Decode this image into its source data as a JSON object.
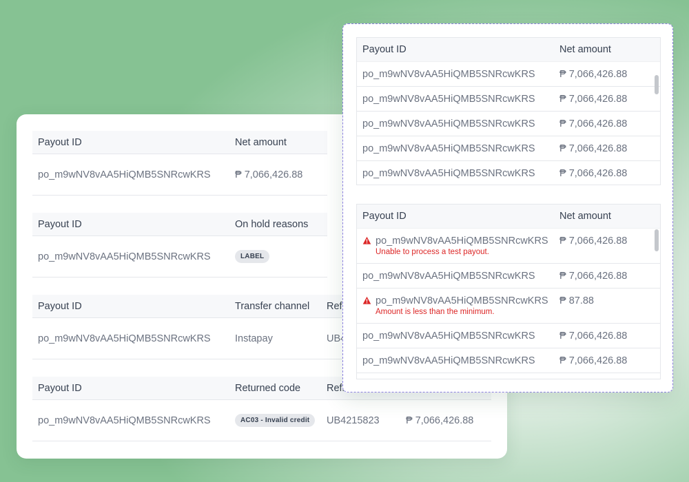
{
  "colors": {
    "error": "#dc2626",
    "dashed_border": "#8b7fe0",
    "header_bg": "#f7f8fa",
    "pill_bg": "#e5e7eb"
  },
  "back_card": {
    "tables": [
      {
        "headers": [
          "Payout ID",
          "Net amount"
        ],
        "row": {
          "payout_id": "po_m9wNV8vAA5HiQMB5SNRcwKRS",
          "col2": "₱ 7,066,426.88"
        }
      },
      {
        "headers": [
          "Payout ID",
          "On hold reasons"
        ],
        "row": {
          "payout_id": "po_m9wNV8vAA5HiQMB5SNRcwKRS",
          "label": "LABEL"
        }
      },
      {
        "headers": [
          "Payout ID",
          "Transfer channel",
          "Refi"
        ],
        "row": {
          "payout_id": "po_m9wNV8vAA5HiQMB5SNRcwKRS",
          "col2": "Instapay",
          "col3": "UB4"
        }
      },
      {
        "headers": [
          "Payout ID",
          "Returned code",
          "Refi"
        ],
        "row": {
          "payout_id": "po_m9wNV8vAA5HiQMB5SNRcwKRS",
          "code_pill": "AC03 - Invalid credit",
          "col3": "UB4215823",
          "col4": "₱ 7,066,426.88"
        }
      }
    ]
  },
  "front_panel": {
    "table1": {
      "headers": [
        "Payout ID",
        "Net amount"
      ],
      "rows": [
        {
          "payout_id": "po_m9wNV8vAA5HiQMB5SNRcwKRS",
          "amount": "₱ 7,066,426.88"
        },
        {
          "payout_id": "po_m9wNV8vAA5HiQMB5SNRcwKRS",
          "amount": "₱ 7,066,426.88"
        },
        {
          "payout_id": "po_m9wNV8vAA5HiQMB5SNRcwKRS",
          "amount": "₱ 7,066,426.88"
        },
        {
          "payout_id": "po_m9wNV8vAA5HiQMB5SNRcwKRS",
          "amount": "₱ 7,066,426.88"
        },
        {
          "payout_id": "po_m9wNV8vAA5HiQMB5SNRcwKRS",
          "amount": "₱ 7,066,426.88"
        }
      ]
    },
    "table2": {
      "headers": [
        "Payout ID",
        "Net amount"
      ],
      "rows": [
        {
          "payout_id": "po_m9wNV8vAA5HiQMB5SNRcwKRS",
          "amount": "₱ 7,066,426.88",
          "error": "Unable to process a test payout."
        },
        {
          "payout_id": "po_m9wNV8vAA5HiQMB5SNRcwKRS",
          "amount": "₱ 7,066,426.88"
        },
        {
          "payout_id": "po_m9wNV8vAA5HiQMB5SNRcwKRS",
          "amount": "₱ 87.88",
          "error": "Amount is less than the minimum."
        },
        {
          "payout_id": "po_m9wNV8vAA5HiQMB5SNRcwKRS",
          "amount": "₱ 7,066,426.88"
        },
        {
          "payout_id": "po_m9wNV8vAA5HiQMB5SNRcwKRS",
          "amount": "₱ 7,066,426.88"
        }
      ]
    }
  }
}
